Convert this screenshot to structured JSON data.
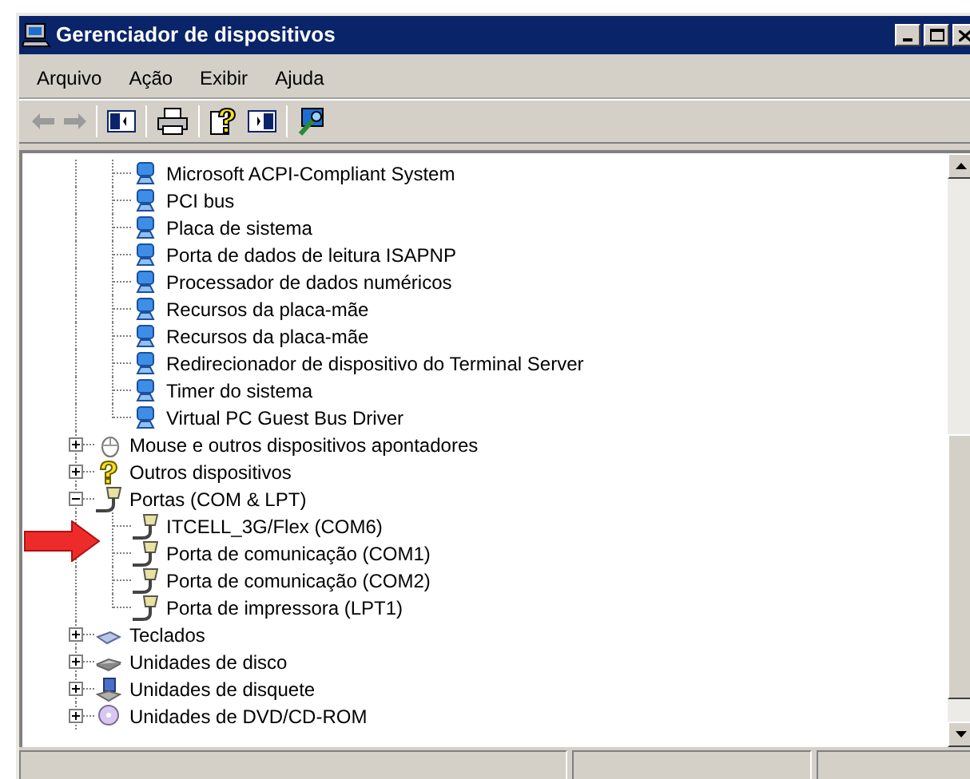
{
  "window": {
    "title": "Gerenciador de dispositivos"
  },
  "menu": [
    "Arquivo",
    "Ação",
    "Exibir",
    "Ajuda"
  ],
  "tree": {
    "partial_group_children": [
      {
        "label": "Microsoft ACPI-Compliant System",
        "kind": "system"
      },
      {
        "label": "PCI bus",
        "kind": "system"
      },
      {
        "label": "Placa de sistema",
        "kind": "system"
      },
      {
        "label": "Porta de dados de leitura ISAPNP",
        "kind": "system"
      },
      {
        "label": "Processador de dados numéricos",
        "kind": "system"
      },
      {
        "label": "Recursos da placa-mãe",
        "kind": "system"
      },
      {
        "label": "Recursos da placa-mãe",
        "kind": "system"
      },
      {
        "label": "Redirecionador de dispositivo do Terminal Server",
        "kind": "system"
      },
      {
        "label": "Timer do sistema",
        "kind": "system"
      },
      {
        "label": "Virtual PC Guest Bus Driver",
        "kind": "system"
      }
    ],
    "items": [
      {
        "label": "Mouse e outros dispositivos apontadores",
        "kind": "mouse",
        "expanded": false
      },
      {
        "label": "Outros dispositivos",
        "kind": "unknown",
        "expanded": false
      },
      {
        "label": "Portas (COM & LPT)",
        "kind": "port",
        "expanded": true,
        "children": [
          {
            "label": "ITCELL_3G/Flex (COM6)",
            "kind": "port"
          },
          {
            "label": "Porta de comunicação (COM1)",
            "kind": "port"
          },
          {
            "label": "Porta de comunicação (COM2)",
            "kind": "port"
          },
          {
            "label": "Porta de impressora (LPT1)",
            "kind": "port"
          }
        ]
      },
      {
        "label": "Teclados",
        "kind": "keyboard",
        "expanded": false
      },
      {
        "label": "Unidades de disco",
        "kind": "disk",
        "expanded": false
      },
      {
        "label": "Unidades de disquete",
        "kind": "floppy",
        "expanded": false
      },
      {
        "label": "Unidades de DVD/CD-ROM",
        "kind": "dvd",
        "expanded": false
      }
    ]
  }
}
